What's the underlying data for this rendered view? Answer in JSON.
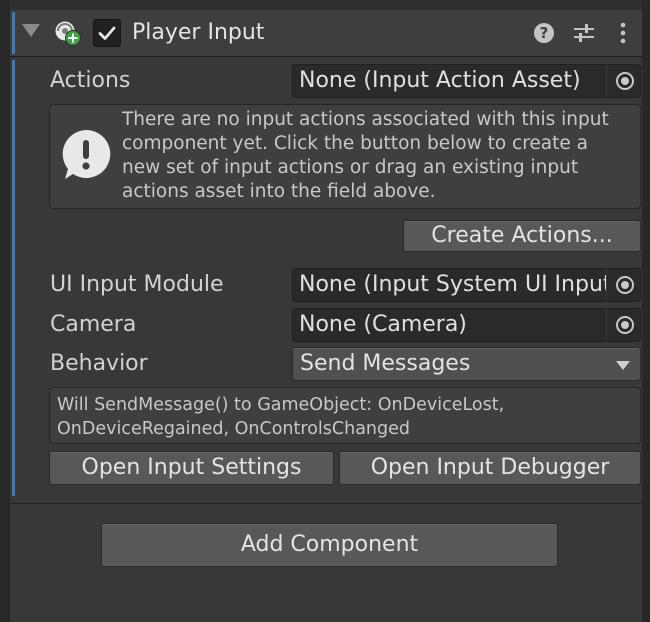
{
  "header": {
    "title": "Player Input",
    "enabled": true,
    "icons": [
      "foldout-arrow-icon",
      "component-icon",
      "help-icon",
      "presets-icon",
      "more-icon"
    ]
  },
  "actions": {
    "label": "Actions",
    "value": "None (Input Action Asset)",
    "help_text": "There are no input actions associated with this input component yet. Click the button below to create a new set of input actions or drag an existing input actions asset into the field above.",
    "create_button": "Create Actions..."
  },
  "ui_input_module": {
    "label": "UI Input Module",
    "value": "None (Input System UI Input Module)"
  },
  "camera": {
    "label": "Camera",
    "value": "None (Camera)"
  },
  "behavior": {
    "label": "Behavior",
    "value": "Send Messages",
    "info_text": "Will SendMessage() to GameObject: OnDeviceLost, OnDeviceRegained, OnControlsChanged"
  },
  "buttons": {
    "open_settings": "Open Input Settings",
    "open_debugger": "Open Input Debugger",
    "add_component": "Add Component"
  },
  "colors": {
    "background": "#383838",
    "header": "#3e3e3e",
    "accent_blue": "#3a79bb",
    "field": "#2a2a2a",
    "button": "#585858"
  }
}
